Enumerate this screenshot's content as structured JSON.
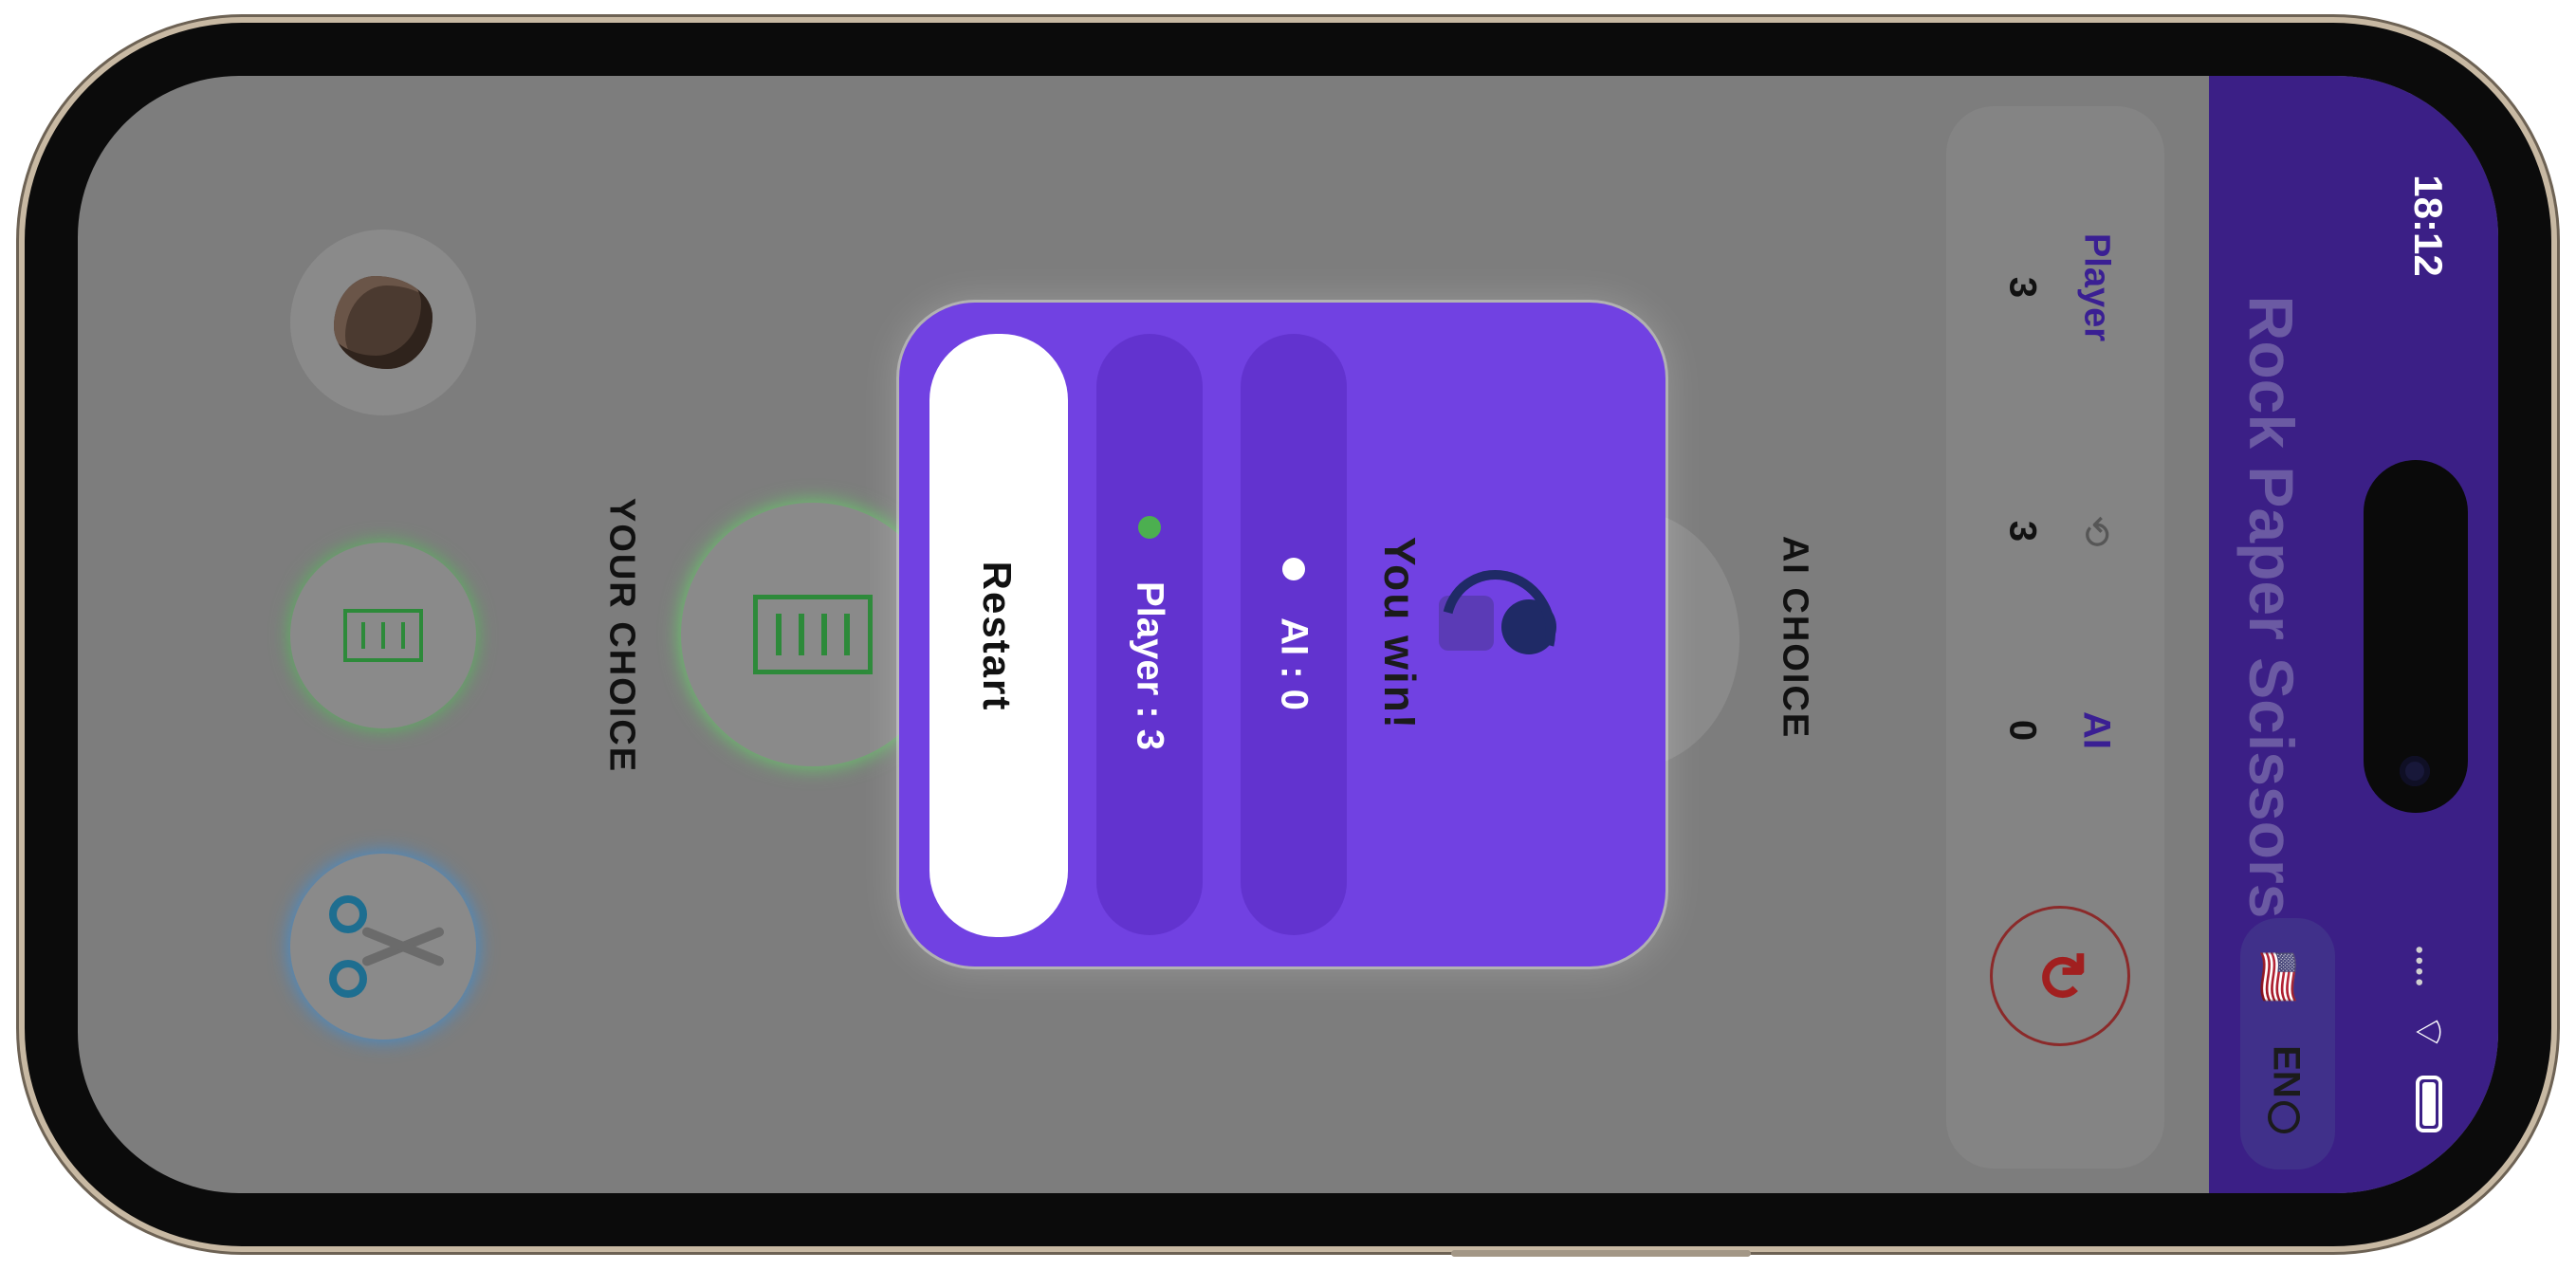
{
  "status_bar": {
    "time": "18:12",
    "wifi_icon": "wifi-icon",
    "battery_icon": "battery-icon"
  },
  "header": {
    "title": "Rock Paper Scissors",
    "language": {
      "flag": "🇺🇸",
      "code": "EN",
      "icon": "globe-icon"
    }
  },
  "scoreboard": {
    "player_label": "Player",
    "player_score": "3",
    "rounds_icon": "round-counter-icon",
    "rounds": "3",
    "ai_label": "AI",
    "ai_score": "0",
    "reset_icon": "refresh-icon"
  },
  "game": {
    "ai_choice_label": "AI CHOICE",
    "your_choice_label": "YOUR CHOICE",
    "selected_choice": "paper",
    "options": [
      "rock",
      "paper",
      "scissors"
    ]
  },
  "modal": {
    "result_text": "You win!",
    "ai_score_text": "AI : 0",
    "player_score_text": "Player : 3",
    "restart_label": "Restart"
  },
  "colors": {
    "header_bg": "#3b1f86",
    "modal_bg": "#7141e2",
    "accent_purple": "#3a1f93",
    "win_green": "#4caf50",
    "reset_red": "#a11f1f"
  }
}
